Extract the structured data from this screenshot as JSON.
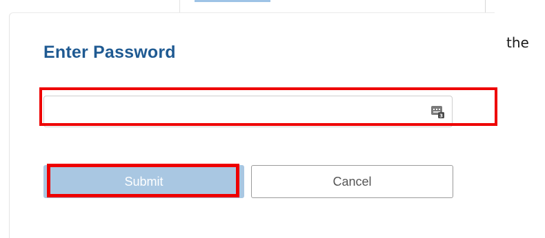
{
  "dialog": {
    "title": "Enter Password",
    "password_field": {
      "value": "",
      "placeholder": "",
      "icon": "password-keypad-icon"
    },
    "buttons": {
      "submit_label": "Submit",
      "cancel_label": "Cancel"
    }
  },
  "side_text": "the",
  "colors": {
    "title": "#1f5a92",
    "submit_bg": "#a9c7e2",
    "highlight": "#ee0000"
  }
}
